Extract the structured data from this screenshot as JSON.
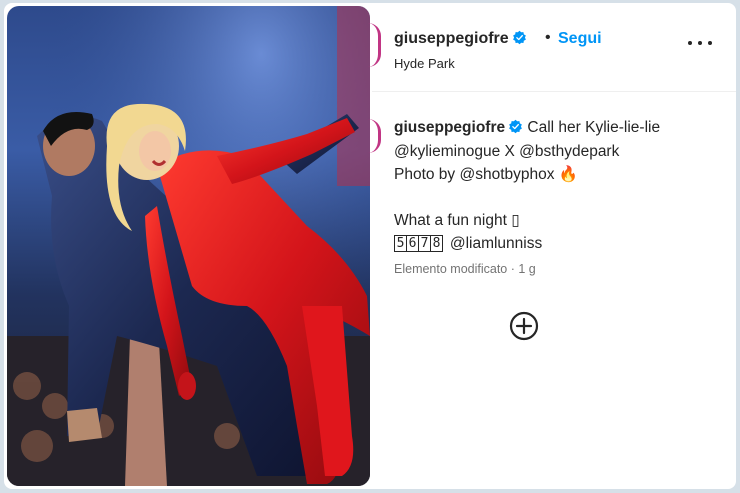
{
  "post": {
    "username": "giuseppegiofre",
    "separator": "•",
    "follow_label": "Segui",
    "location": "Hyde Park",
    "more_label": "Altre opzioni"
  },
  "caption": {
    "username": "giuseppegiofre",
    "line1_text": "Call her Kylie-lie-lie",
    "mention_1": "@kylieminogue",
    "joiner": "X",
    "mention_2": "@bsthydepark",
    "line3_text": "Photo by",
    "mention_3": "@shotbyphox",
    "fire_emoji": "🔥",
    "line5_text": "What a fun night",
    "unsupported_emoji": "▯",
    "keycaps": "5678",
    "mention_4": "@liamlunniss"
  },
  "meta": {
    "edited_text": "Elemento modificato · 1 g"
  },
  "icons": {
    "verified": "verified-badge-icon",
    "more": "more-options-icon",
    "add": "add-comment-icon"
  },
  "colors": {
    "accent_blue": "#0095f6",
    "verified_blue": "#0095f6",
    "text": "#262626",
    "muted": "#737373",
    "story_ring": "#c13584",
    "costume_red": "#d3141a",
    "suit_navy": "#1c2850"
  }
}
